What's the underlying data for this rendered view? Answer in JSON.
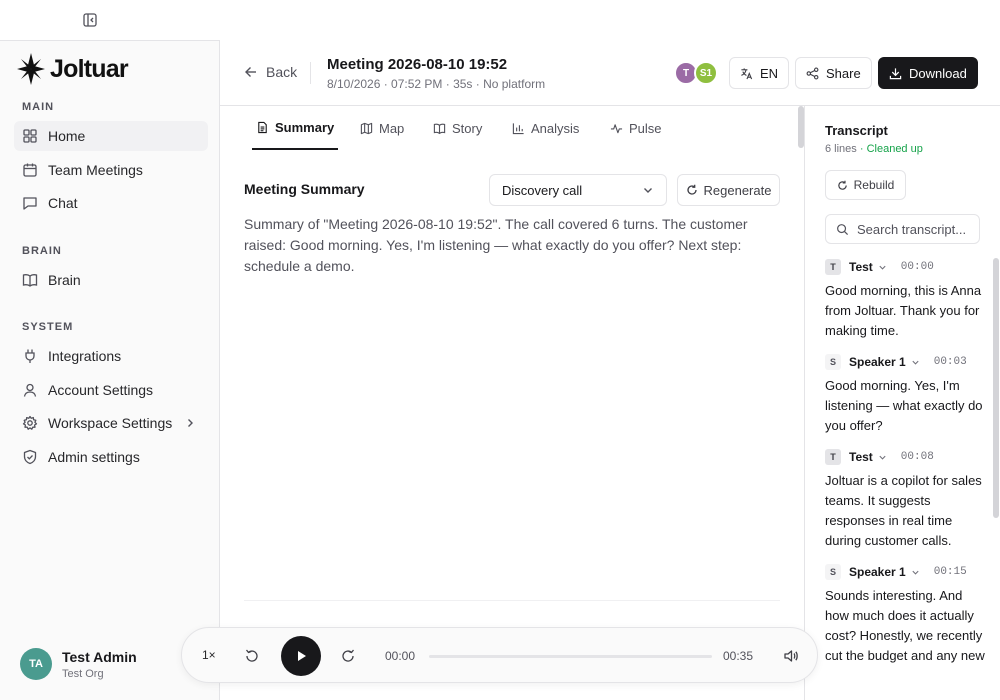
{
  "brand": {
    "name": "Joltuar"
  },
  "sidebar": {
    "sections": [
      {
        "label": "MAIN",
        "items": [
          {
            "label": "Home",
            "icon": "layout-grid-icon",
            "active": true
          },
          {
            "label": "Team Meetings",
            "icon": "calendar-icon"
          },
          {
            "label": "Chat",
            "icon": "message-square-icon"
          }
        ]
      },
      {
        "label": "BRAIN",
        "items": [
          {
            "label": "Brain",
            "icon": "book-open-icon"
          }
        ]
      },
      {
        "label": "SYSTEM",
        "items": [
          {
            "label": "Integrations",
            "icon": "plug-icon"
          },
          {
            "label": "Account Settings",
            "icon": "user-icon"
          },
          {
            "label": "Workspace Settings",
            "icon": "gear-icon",
            "has_submenu": true
          },
          {
            "label": "Admin settings",
            "icon": "shield-check-icon"
          }
        ]
      }
    ],
    "user": {
      "initials": "TA",
      "name": "Test Admin",
      "org": "Test Org"
    }
  },
  "header": {
    "back_label": "Back",
    "title": "Meeting 2026-08-10 19:52",
    "meta": "8/10/2026 · 07:52 PM · 35s · No platform",
    "participants": [
      {
        "initials": "T",
        "color": "#9b6ba5"
      },
      {
        "initials": "S1",
        "color": "#8fbf3f"
      }
    ],
    "language_label": "EN",
    "share_label": "Share",
    "download_label": "Download"
  },
  "tabs": [
    {
      "label": "Summary",
      "icon": "file-text-icon",
      "active": true
    },
    {
      "label": "Map",
      "icon": "map-icon"
    },
    {
      "label": "Story",
      "icon": "book-open-icon"
    },
    {
      "label": "Analysis",
      "icon": "bar-chart-icon"
    },
    {
      "label": "Pulse",
      "icon": "activity-icon"
    }
  ],
  "summary": {
    "title": "Meeting Summary",
    "template_selected": "Discovery call",
    "regenerate_label": "Regenerate",
    "text": "Summary of \"Meeting 2026-08-10 19:52\". The call covered 6 turns. The customer raised: Good morning. Yes, I'm listening — what exactly do you offer? Next step: schedule a demo."
  },
  "transcript": {
    "title": "Transcript",
    "lines_count": "6 lines",
    "status": "· Cleaned up",
    "rebuild_label": "Rebuild",
    "search_placeholder": "Search transcript...",
    "entries": [
      {
        "badge": "T",
        "speaker": "Test",
        "time": "00:00",
        "text": "Good morning, this is Anna from Joltuar. Thank you for making time."
      },
      {
        "badge": "S",
        "speaker": "Speaker 1",
        "time": "00:03",
        "text": "Good morning. Yes, I'm listening — what exactly do you offer?"
      },
      {
        "badge": "T",
        "speaker": "Test",
        "time": "00:08",
        "text": "Joltuar is a copilot for sales teams. It suggests responses in real time during customer calls."
      },
      {
        "badge": "S",
        "speaker": "Speaker 1",
        "time": "00:15",
        "text": "Sounds interesting. And how much does it actually cost? Honestly, we recently cut the budget and any new"
      }
    ]
  },
  "player": {
    "speed": "1×",
    "current": "00:00",
    "duration": "00:35",
    "progress": 0
  }
}
